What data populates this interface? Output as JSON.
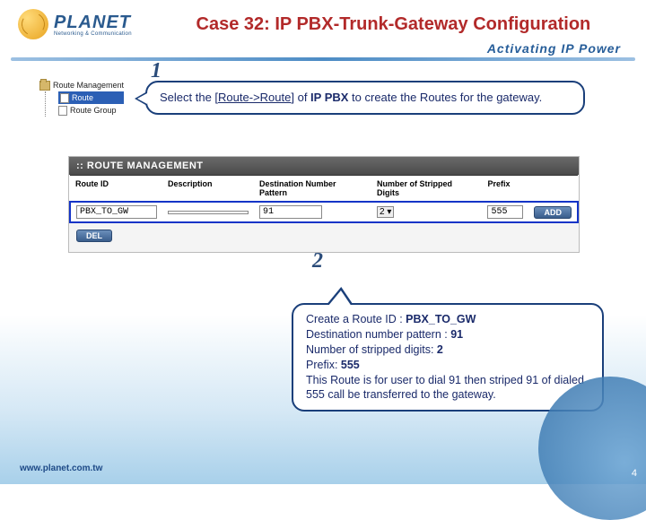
{
  "logo": {
    "brand": "PLANET",
    "tagline": "Networking & Communication"
  },
  "title": "Case 32: IP PBX-Trunk-Gateway Configuration",
  "subtitle": "Activating IP Power",
  "steps": {
    "one": "1",
    "two": "2"
  },
  "tree": {
    "root": "Route Management",
    "items": [
      "Route",
      "Route Group"
    ]
  },
  "callout1": {
    "pre": "Select the [",
    "link": "Route->Route",
    "post": "] of ",
    "bold": "IP PBX",
    "post2": " to create the Routes for the gateway."
  },
  "panel": {
    "title": ":: ROUTE MANAGEMENT",
    "headers": [
      "Route ID",
      "Description",
      "Destination Number Pattern",
      "Number of Stripped Digits",
      "Prefix",
      ""
    ],
    "row": {
      "route_id": "PBX_TO_GW",
      "description": "",
      "dest_pattern": "91",
      "stripped": "2",
      "prefix": "555",
      "add": "ADD"
    },
    "del": "DEL"
  },
  "callout2": {
    "l1a": "Create a Route ID : ",
    "l1b": "PBX_TO_GW",
    "l2a": "Destination number pattern : ",
    "l2b": "91",
    "l3a": "Number of stripped digits: ",
    "l3b": "2",
    "l4a": "Prefix: ",
    "l4b": "555",
    "l5": "This Route is for user to dial 91 then striped  91 of dialed 555 call be transferred to the gateway."
  },
  "footer": {
    "url": "www.planet.com.tw",
    "page": "4"
  }
}
